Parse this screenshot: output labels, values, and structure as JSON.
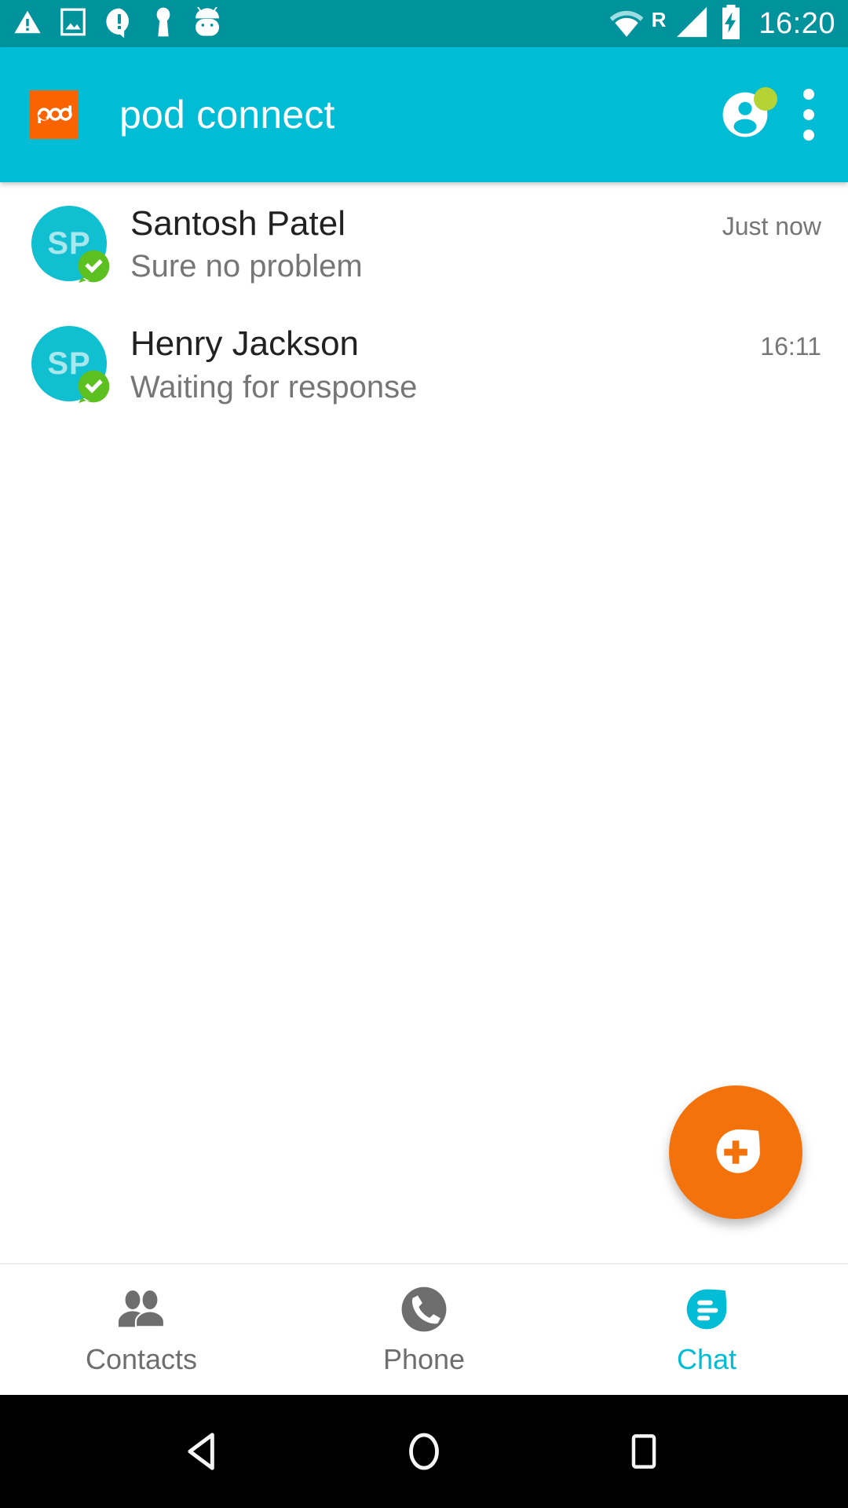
{
  "status_bar": {
    "background": "#00939c",
    "icons": [
      "warning-triangle-icon",
      "screenshot-image-icon",
      "alert-bubble-icon",
      "keyhole-person-icon",
      "android-head-icon"
    ],
    "wifi_icon": "wifi-icon",
    "roaming_label": "R",
    "signal_icon": "cellular-signal-icon",
    "battery_icon": "battery-charging-icon",
    "clock": "16:20"
  },
  "app_bar": {
    "background": "#00bcd4",
    "logo_text": "pod",
    "logo_background": "#f96302",
    "title": "pod connect",
    "account_icon": "account-circle-icon",
    "presence_color": "#b5d334",
    "overflow_icon": "overflow-menu-icon"
  },
  "chat_list": {
    "rows": [
      {
        "initials": "SP",
        "name": "Santosh Patel",
        "preview": "Sure no problem",
        "time": "Just now",
        "avatar_color": "#10bfd0",
        "badge": "verified-check-icon"
      },
      {
        "initials": "SP",
        "name": "Henry Jackson",
        "preview": "Waiting for response",
        "time": "16:11",
        "avatar_color": "#10bfd0",
        "badge": "verified-check-icon"
      }
    ]
  },
  "fab": {
    "icon": "new-chat-plus-icon",
    "color": "#f4720b"
  },
  "bottom_nav": {
    "active_color": "#00bcd4",
    "inactive_color": "#6e6e6e",
    "items": [
      {
        "label": "Contacts",
        "icon": "contacts-people-icon",
        "active": false
      },
      {
        "label": "Phone",
        "icon": "phone-handset-icon",
        "active": false
      },
      {
        "label": "Chat",
        "icon": "chat-bubble-icon",
        "active": true
      }
    ]
  },
  "android_nav": {
    "back": "back-triangle-icon",
    "home": "home-circle-icon",
    "recents": "recents-square-icon"
  }
}
